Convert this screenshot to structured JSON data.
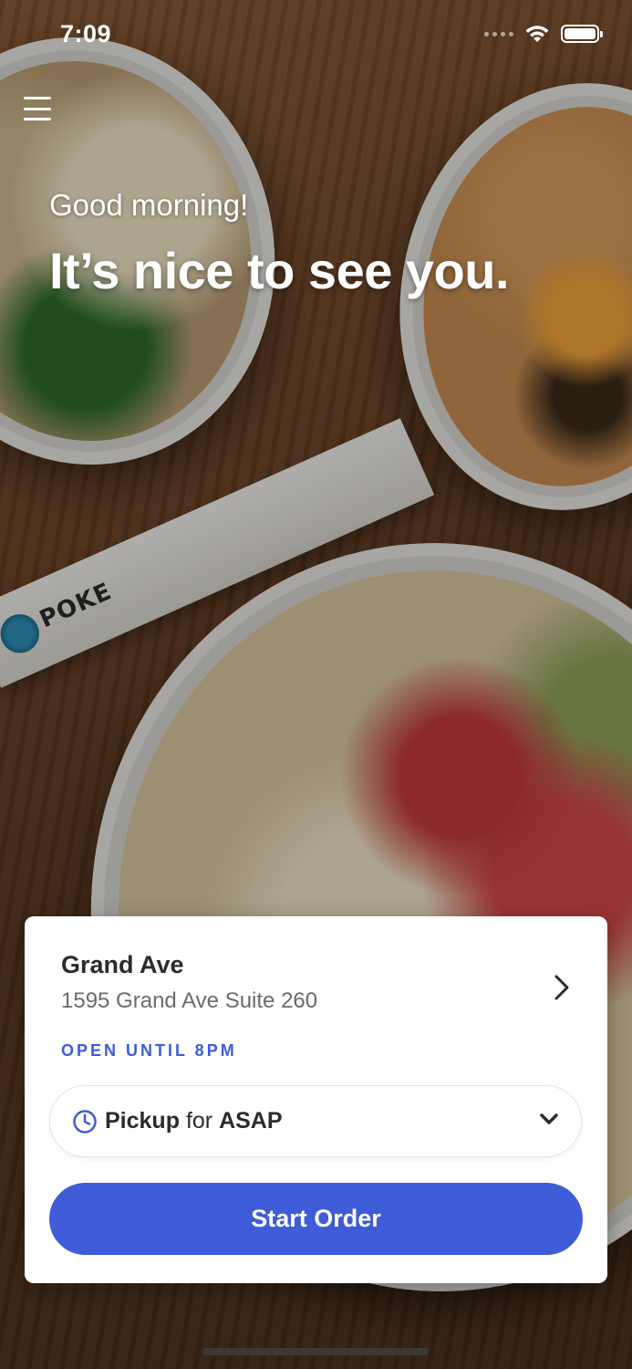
{
  "status_bar": {
    "time": "7:09"
  },
  "hero": {
    "greeting": "Good morning!",
    "headline": "It’s nice to see you."
  },
  "background": {
    "chopsticks_brand": "POKE"
  },
  "location": {
    "name": "Grand Ave",
    "address": "1595 Grand Ave Suite 260",
    "hours": "OPEN UNTIL 8PM"
  },
  "order_mode": {
    "mode": "Pickup",
    "connector": "for",
    "time": "ASAP"
  },
  "start_button_label": "Start Order",
  "colors": {
    "accent": "#3e5bd8",
    "card": "#ffffff",
    "text_dark": "#2b2b2b",
    "text_muted": "#6b6b6b"
  },
  "icons": [
    "menu-icon",
    "wifi-icon",
    "battery-icon",
    "chevron-right-icon",
    "clock-icon",
    "chevron-down-icon"
  ]
}
